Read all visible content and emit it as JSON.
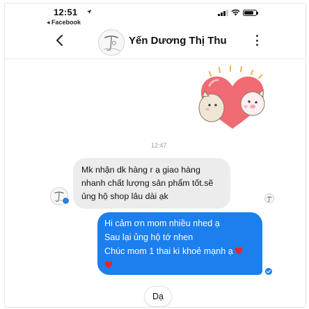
{
  "status_bar": {
    "time": "12:51",
    "location_arrow": "◀",
    "back_app": "◂ Facebook",
    "battery_level_percent": 90
  },
  "header": {
    "contact_name": "Yến Dương Thị Thu",
    "icons": [
      "chevron-left-icon",
      "more-vertical-icon"
    ]
  },
  "conversation": {
    "timestamp": "12:47",
    "received_message": [
      "Mk nhận dk hàng r ạ giao hàng",
      "nhanh chất lượng sản phẩm tốt.sẽ",
      "ủng hộ shop lâu dài ạk"
    ],
    "sent_message": [
      "Hi cảm ơn mom nhiều nhed ạ",
      "Sau lại ủng hộ tớ nhen",
      "Chúc mom 1 thai kì khoẻ mạnh ạ"
    ],
    "heart_color": "#e8252a"
  },
  "quick_reply": {
    "label": "Dạ"
  },
  "colors": {
    "accent_blue": "#1b7fee",
    "received_bubble": "#ececec"
  }
}
